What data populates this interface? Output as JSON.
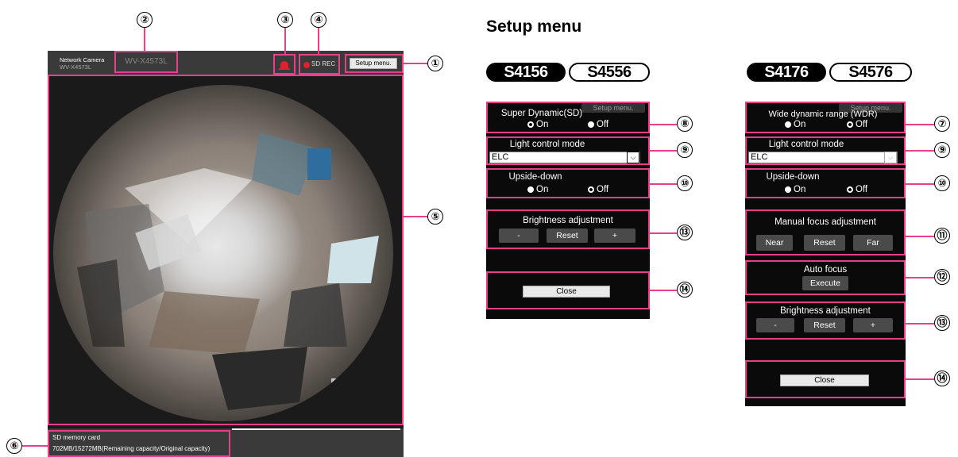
{
  "camera": {
    "brand": "Network Camera",
    "brand_sub": "WV-X4573L",
    "model": "WV-X4573L",
    "sd_rec": "SD REC",
    "setup_button": "Setup menu.",
    "sd_title": "SD memory card",
    "sd_capacity": "702MB/15272MB(Remaining capacity/Original capacity)"
  },
  "callouts": {
    "c1": "①",
    "c2": "②",
    "c3": "③",
    "c4": "④",
    "c5": "⑤",
    "c6": "⑥",
    "c7": "⑦",
    "c8": "⑧",
    "c9": "⑨",
    "c10": "⑩",
    "c11": "⑪",
    "c12": "⑫",
    "c13": "⑬",
    "c14": "⑭"
  },
  "setup": {
    "heading": "Setup menu",
    "models_left": [
      "S4156",
      "S4556"
    ],
    "models_right": [
      "S4176",
      "S4576"
    ],
    "ghost_label": "Setup menu.",
    "left": {
      "sd_title": "Super Dynamic(SD)",
      "on": "On",
      "off": "Off",
      "light_title": "Light control mode",
      "light_value": "ELC",
      "upside_title": "Upside-down",
      "brightness_title": "Brightness adjustment",
      "minus": "-",
      "reset": "Reset",
      "plus": "+",
      "close": "Close"
    },
    "right": {
      "wdr_title": "Wide dynamic range (WDR)",
      "on": "On",
      "off": "Off",
      "light_title": "Light control mode",
      "light_value": "ELC",
      "upside_title": "Upside-down",
      "focus_title": "Manual focus adjustment",
      "near": "Near",
      "reset": "Reset",
      "far": "Far",
      "auto_title": "Auto focus",
      "execute": "Execute",
      "brightness_title": "Brightness adjustment",
      "minus": "-",
      "reset2": "Reset",
      "plus": "+",
      "close": "Close"
    }
  }
}
